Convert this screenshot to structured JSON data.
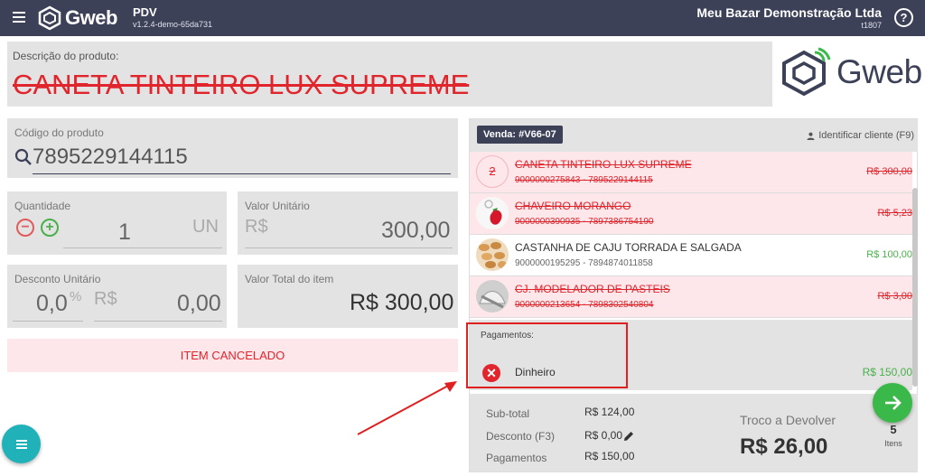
{
  "header": {
    "logo_text": "Gweb",
    "app_name": "PDV",
    "app_version": "v1.2.4-demo-65da731",
    "company_name": "Meu Bazar Demonstração Ltda",
    "company_code": "t1807",
    "help_symbol": "?"
  },
  "product": {
    "description_label": "Descrição do produto:",
    "description_value": "CANETA TINTEIRO LUX SUPREME",
    "logo_text": "Gweb"
  },
  "code": {
    "label": "Código do produto",
    "value": "7895229144115"
  },
  "quantity": {
    "label": "Quantidade",
    "value": "1",
    "unit": "UN",
    "minus": "−",
    "plus": "+"
  },
  "unit_price": {
    "label": "Valor Unitário",
    "currency": "R$",
    "value": "300,00"
  },
  "discount": {
    "label": "Desconto Unitário",
    "percent_value": "0,0",
    "percent_sign": "%",
    "currency": "R$",
    "value": "0,00"
  },
  "item_total": {
    "label": "Valor Total do item",
    "value": "R$ 300,00"
  },
  "cancel_banner": "ITEM CANCELADO",
  "sale": {
    "badge": "Venda: #V66-07",
    "identify_client": "Identificar cliente (F9)",
    "items": [
      {
        "name": "CANETA TINTEIRO LUX SUPREME",
        "codes": "9000000275843 - 7895229144115",
        "price": "R$ 300,00",
        "status": "cancelled",
        "thumb_text": "2"
      },
      {
        "name": "CHAVEIRO MORANGO",
        "codes": "9000000390935 - 7897386754190",
        "price": "R$ 5,23",
        "status": "cancelled",
        "thumb_text": ""
      },
      {
        "name": "CASTANHA DE CAJU TORRADA E SALGADA",
        "codes": "9000000195295 - 7894874011858",
        "price": "R$ 100,00",
        "status": "active",
        "thumb_text": ""
      },
      {
        "name": "CJ. MODELADOR DE PASTEIS",
        "codes": "9000000213654 - 7898302540804",
        "price": "R$ 3,00",
        "status": "cancelled",
        "thumb_text": ""
      }
    ]
  },
  "payments": {
    "title": "Pagamentos:",
    "items": [
      {
        "name": "Dinheiro",
        "value": "R$ 150,00",
        "icon": "close-icon"
      }
    ]
  },
  "totals": {
    "subtotal_label": "Sub-total",
    "subtotal_value": "R$ 124,00",
    "discount_label": "Desconto (F3)",
    "discount_value": "R$ 0,00",
    "payments_label": "Pagamentos",
    "payments_value": "R$ 150,00",
    "change_label": "Troco a Devolver",
    "change_value": "R$ 26,00",
    "items_count": "5",
    "items_label": "Itens"
  },
  "colors": {
    "topbar": "#3c4158",
    "accent_green": "#3bb84a",
    "cancel_red": "#e0252c",
    "fab_teal": "#20b2b8"
  }
}
